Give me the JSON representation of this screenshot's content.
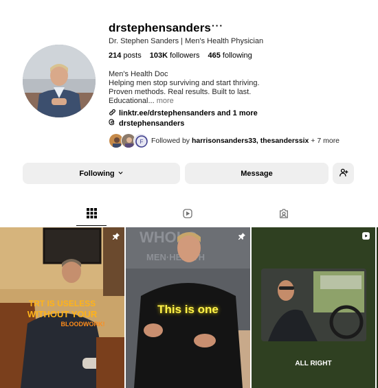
{
  "profile": {
    "username": "drstephensanders",
    "more_icon": "ellipsis-icon",
    "full_name": "Dr. Stephen Sanders | Men's Health Physician",
    "stats": [
      {
        "count": "214",
        "label": "posts"
      },
      {
        "count": "103K",
        "label": "followers"
      },
      {
        "count": "465",
        "label": "following"
      }
    ],
    "bio_lines": [
      "Men's Health Doc",
      "Helping men stop surviving and start thriving.",
      "Proven methods. Real results. Built to last.",
      "Educational..."
    ],
    "bio_more": "more",
    "link_text": "linktr.ee/drstephensanders and 1 more",
    "threads_handle": "drstephensanders",
    "followed_by_prefix": "Followed by",
    "followed_by_names": "harrisonsanders33, thesanderssix",
    "followed_by_suffix": "+ 7 more"
  },
  "actions": {
    "following_label": "Following",
    "message_label": "Message"
  },
  "tabs": [
    {
      "name": "posts",
      "icon": "grid-icon",
      "active": true
    },
    {
      "name": "reels",
      "icon": "reels-icon",
      "active": false
    },
    {
      "name": "tagged",
      "icon": "tagged-icon",
      "active": false
    }
  ],
  "grid": [
    {
      "caption_lines": [
        "TRT IS USELESS",
        "WITHOUT YOUR",
        "BLOODWORK!"
      ],
      "pinned": true
    },
    {
      "caption": "This is one",
      "pinned": true
    },
    {
      "caption": "ALL RIGHT",
      "reel": true
    }
  ],
  "colors": {
    "button_bg": "#efefef",
    "caption_orange": "#ffb31a",
    "caption_yellow": "#fff34a",
    "text_secondary": "#737373"
  }
}
